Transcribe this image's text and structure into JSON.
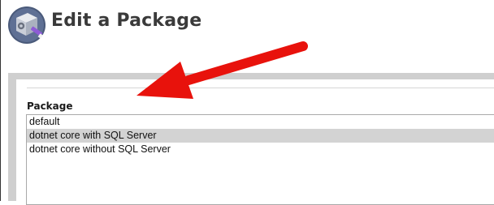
{
  "header": {
    "title": "Edit a Package",
    "icon": "package-settings-icon"
  },
  "form": {
    "package_label": "Package",
    "package_options": [
      {
        "label": "default",
        "selected": false
      },
      {
        "label": "dotnet core with SQL Server",
        "selected": true
      },
      {
        "label": "dotnet core without SQL Server",
        "selected": false
      }
    ]
  },
  "annotation": {
    "icon": "red-pointer-arrow-icon",
    "color": "#e8120c"
  }
}
